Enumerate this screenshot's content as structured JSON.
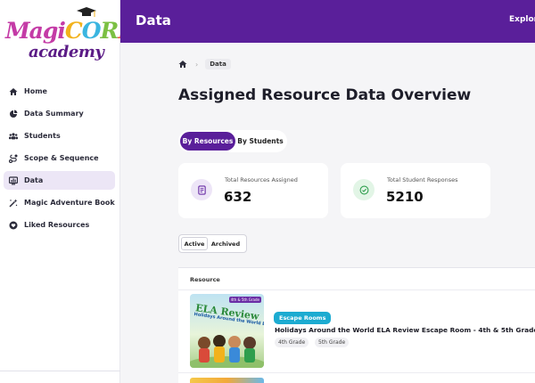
{
  "logo": {
    "top_text": "MagiCORE",
    "bottom_text": "academy"
  },
  "sidebar": {
    "items": [
      {
        "label": "Home",
        "icon": "home-icon"
      },
      {
        "label": "Data Summary",
        "icon": "pie-chart-icon"
      },
      {
        "label": "Students",
        "icon": "students-icon"
      },
      {
        "label": "Scope & Sequence",
        "icon": "route-icon"
      },
      {
        "label": "Data",
        "icon": "data-icon",
        "active": true
      },
      {
        "label": "Magic Adventure Book",
        "icon": "wand-icon"
      },
      {
        "label": "Liked Resources",
        "icon": "heart-icon"
      }
    ]
  },
  "header": {
    "title": "Data",
    "explore": "Explore"
  },
  "breadcrumb": {
    "current": "Data"
  },
  "page": {
    "title": "Assigned Resource Data Overview"
  },
  "view_toggle": {
    "by_resources": "By Resources",
    "by_students": "By Students"
  },
  "stats": {
    "resources": {
      "label": "Total Resources Assigned",
      "value": "632"
    },
    "responses": {
      "label": "Total Student Responses",
      "value": "5210"
    }
  },
  "filter": {
    "active": "Active",
    "archived": "Archived"
  },
  "table": {
    "header": "Resource",
    "rows": [
      {
        "thumb_tag": "4th & 5th Grade",
        "thumb_title": "ELA Review",
        "thumb_subtitle": "Holidays Around the World Escape Room",
        "category": "Escape Rooms",
        "title": "Holidays Around the World ELA Review Escape Room - 4th & 5th Grade",
        "grades": [
          "4th Grade",
          "5th Grade"
        ]
      }
    ]
  },
  "colors": {
    "brand": "#5a1f9a",
    "category_badge": "#1cabd1"
  }
}
